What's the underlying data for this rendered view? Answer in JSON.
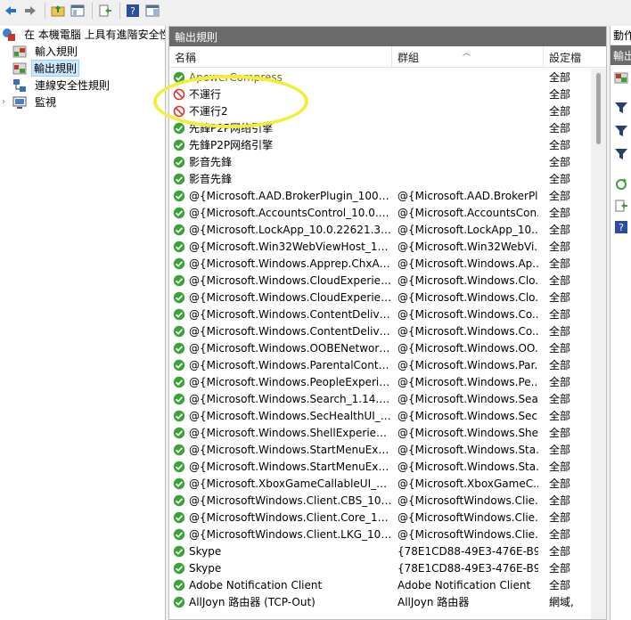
{
  "toolbar": {
    "buttons": [
      "back-icon",
      "forward-icon",
      "folder-up-icon",
      "show-hide-tree-icon",
      "export-list-icon",
      "help-icon",
      "properties-pane-icon"
    ]
  },
  "tree": {
    "root_label": "在 本機電腦 上具有進階安全性的",
    "items": [
      {
        "label": "輸入規則",
        "icon": "inbound-rules-icon"
      },
      {
        "label": "輸出規則",
        "icon": "outbound-rules-icon"
      },
      {
        "label": "連線安全性規則",
        "icon": "connection-security-icon"
      },
      {
        "label": "監視",
        "icon": "monitor-icon"
      }
    ]
  },
  "main": {
    "header_title": "輸出規則",
    "columns": {
      "name": "名稱",
      "group": "群組",
      "profile": "設定檔"
    },
    "rows": [
      {
        "name": "ApowerCompress",
        "group": "",
        "profile": "全部",
        "status": "allow",
        "style": "golden"
      },
      {
        "name": "不運行",
        "group": "",
        "profile": "全部",
        "status": "block",
        "style": "normal"
      },
      {
        "name": "不運行2",
        "group": "",
        "profile": "全部",
        "status": "block",
        "style": "normal"
      },
      {
        "name": "先鋒P2P网络引擎",
        "group": "",
        "profile": "全部",
        "status": "allow",
        "style": "normal"
      },
      {
        "name": "先鋒P2P网络引擎",
        "group": "",
        "profile": "全部",
        "status": "allow",
        "style": "normal"
      },
      {
        "name": "影音先鋒",
        "group": "",
        "profile": "全部",
        "status": "allow",
        "style": "normal"
      },
      {
        "name": "影音先鋒",
        "group": "",
        "profile": "全部",
        "status": "allow",
        "style": "normal"
      },
      {
        "name": "@{Microsoft.AAD.BrokerPlugin_1000.1...",
        "group": "@{Microsoft.AAD.BrokerPl...",
        "profile": "全部",
        "status": "allow",
        "style": "normal"
      },
      {
        "name": "@{Microsoft.AccountsControl_10.0.22...",
        "group": "@{Microsoft.AccountsCon...",
        "profile": "全部",
        "status": "allow",
        "style": "normal"
      },
      {
        "name": "@{Microsoft.LockApp_10.0.22621.323...",
        "group": "@{Microsoft.LockApp_10....",
        "profile": "全部",
        "status": "allow",
        "style": "normal"
      },
      {
        "name": "@{Microsoft.Win32WebViewHost_10....",
        "group": "@{Microsoft.Win32WebVi...",
        "profile": "全部",
        "status": "allow",
        "style": "normal"
      },
      {
        "name": "@{Microsoft.Windows.Apprep.ChxAp...",
        "group": "@{Microsoft.Windows.Ap...",
        "profile": "全部",
        "status": "allow",
        "style": "normal"
      },
      {
        "name": "@{Microsoft.Windows.CloudExperienc...",
        "group": "@{Microsoft.Windows.Clo...",
        "profile": "全部",
        "status": "allow",
        "style": "normal"
      },
      {
        "name": "@{Microsoft.Windows.CloudExperienc...",
        "group": "@{Microsoft.Windows.Clo...",
        "profile": "全部",
        "status": "allow",
        "style": "normal"
      },
      {
        "name": "@{Microsoft.Windows.ContentDeliver...",
        "group": "@{Microsoft.Windows.Co...",
        "profile": "全部",
        "status": "allow",
        "style": "normal"
      },
      {
        "name": "@{Microsoft.Windows.ContentDeliver...",
        "group": "@{Microsoft.Windows.Co...",
        "profile": "全部",
        "status": "allow",
        "style": "normal"
      },
      {
        "name": "@{Microsoft.Windows.OOBENetwork...",
        "group": "@{Microsoft.Windows.OO...",
        "profile": "全部",
        "status": "allow",
        "style": "normal"
      },
      {
        "name": "@{Microsoft.Windows.ParentalControl...",
        "group": "@{Microsoft.Windows.Par...",
        "profile": "全部",
        "status": "allow",
        "style": "normal"
      },
      {
        "name": "@{Microsoft.Windows.PeopleExperien...",
        "group": "@{Microsoft.Windows.Pe...",
        "profile": "全部",
        "status": "allow",
        "style": "normal"
      },
      {
        "name": "@{Microsoft.Windows.Search_1.14.12....",
        "group": "@{Microsoft.Windows.Sea...",
        "profile": "全部",
        "status": "allow",
        "style": "normal"
      },
      {
        "name": "@{Microsoft.Windows.SecHealthUI_10...",
        "group": "@{Microsoft.Windows.Sec...",
        "profile": "全部",
        "status": "allow",
        "style": "normal"
      },
      {
        "name": "@{Microsoft.Windows.ShellExperience...",
        "group": "@{Microsoft.Windows.She...",
        "profile": "全部",
        "status": "allow",
        "style": "normal"
      },
      {
        "name": "@{Microsoft.Windows.StartMenuExpe...",
        "group": "@{Microsoft.Windows.Sta...",
        "profile": "全部",
        "status": "allow",
        "style": "normal"
      },
      {
        "name": "@{Microsoft.Windows.StartMenuExpe...",
        "group": "@{Microsoft.Windows.Sta...",
        "profile": "全部",
        "status": "allow",
        "style": "normal"
      },
      {
        "name": "@{Microsoft.XboxGameCallableUI_10...",
        "group": "@{Microsoft.XboxGameC...",
        "profile": "全部",
        "status": "allow",
        "style": "normal"
      },
      {
        "name": "@{MicrosoftWindows.Client.CBS_1000...",
        "group": "@{MicrosoftWindows.Clie...",
        "profile": "全部",
        "status": "allow",
        "style": "normal"
      },
      {
        "name": "@{MicrosoftWindows.Client.Core_1000...",
        "group": "@{MicrosoftWindows.Clie...",
        "profile": "全部",
        "status": "allow",
        "style": "normal"
      },
      {
        "name": "@{MicrosoftWindows.Client.LKG_1000...",
        "group": "@{MicrosoftWindows.Clie...",
        "profile": "全部",
        "status": "allow",
        "style": "normal"
      },
      {
        "name": "Skype",
        "group": "{78E1CD88-49E3-476E-B9...",
        "profile": "全部",
        "status": "allow",
        "style": "normal"
      },
      {
        "name": "Skype",
        "group": "{78E1CD88-49E3-476E-B9...",
        "profile": "全部",
        "status": "allow",
        "style": "normal"
      },
      {
        "name": "Adobe Notification Client",
        "group": "Adobe Notification Client",
        "profile": "全部",
        "status": "allow",
        "style": "normal"
      },
      {
        "name": "AllJoyn 路由器 (TCP-Out)",
        "group": "AllJoyn 路由器",
        "profile": "網域,",
        "status": "allow",
        "style": "normal"
      }
    ]
  },
  "actions": {
    "header": "動作",
    "subheader": "輸出",
    "items": [
      "new-rule-icon",
      "filter-by-profile-icon",
      "filter-by-state-icon",
      "filter-by-group-icon",
      "refresh-icon",
      "export-list-icon",
      "help-icon"
    ]
  },
  "colors": {
    "pane_header_bg": "#6b6b6b",
    "allow_green": "#3aa335",
    "block_red": "#d33",
    "annotation_yellow": "#f2ef3a",
    "selection_blue": "#cce8ff"
  }
}
